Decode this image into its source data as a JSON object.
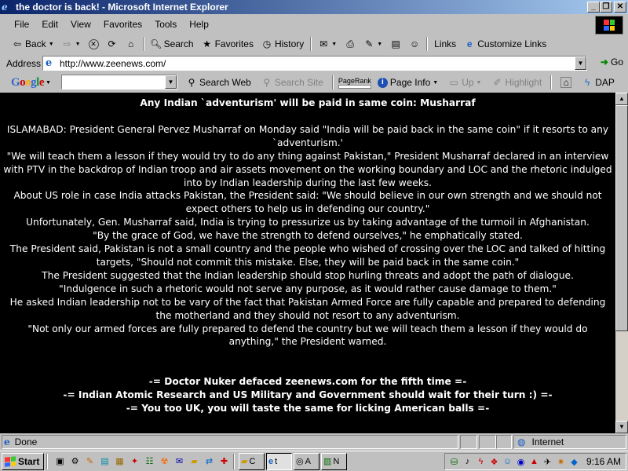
{
  "window": {
    "title": "the doctor is back! - Microsoft Internet Explorer",
    "min_label": "_",
    "max_label": "❐",
    "close_label": "✕"
  },
  "menu": {
    "items": [
      "File",
      "Edit",
      "View",
      "Favorites",
      "Tools",
      "Help"
    ]
  },
  "toolbar": {
    "back": "Back",
    "search": "Search",
    "favorites": "Favorites",
    "history": "History",
    "links": "Links",
    "customize_links": "Customize Links"
  },
  "address": {
    "label": "Address",
    "url": "http://www.zeenews.com/",
    "go": "Go"
  },
  "googlebar": {
    "logo": "Google",
    "search_web": "Search Web",
    "search_site": "Search Site",
    "pagerank": "PageRank",
    "page_info": "Page Info",
    "up": "Up",
    "highlight": "Highlight",
    "dap": "DAP"
  },
  "article": {
    "headline": "Any Indian `adventurism' will be paid in same coin: Musharraf",
    "paragraphs": [
      "ISLAMABAD: President General Pervez Musharraf on Monday said \"India will be paid back in the same coin\" if it resorts to any `adventurism.'",
      "\"We will teach them a lesson if they would try to do any thing against Pakistan,\" President  Musharraf declared in an interview with PTV in the backdrop of Indian troop and air assets  movement on the working boundary and LOC and the rhetoric indulged into by Indian leadership during the last few weeks.",
      "About US role in case India attacks Pakistan, the President said: \"We should believe in our own strength and we should not expect others to help us in defending our country.\"",
      "Unfortunately, Gen. Musharraf said, India is trying to pressurize us by taking advantage of the turmoil in Afghanistan.",
      "\"By the grace of God, we have the strength to defend ourselves,\" he emphatically stated.",
      "The President said, Pakistan is not a small country and the people who wished of crossing over the LOC and talked of hitting targets, \"Should not commit this mistake. Else, they will be paid back in the same coin.\"",
      "The President suggested that the Indian leadership should stop hurling threats and adopt the path of dialogue.",
      "\"Indulgence in such a rhetoric would not serve any purpose, as it would rather cause damage to them.\"",
      "He asked Indian leadership not to be vary of the fact that Pakistan Armed Force are fully capable and prepared to defending the motherland and they should not resort to any adventurism.",
      "\"Not only our armed forces are fully prepared to defend the country but we will teach them a lesson if they would do anything,\" the President warned."
    ],
    "deface_lines": [
      "-= Doctor Nuker defaced zeenews.com for the fifth time =-",
      "-= Indian Atomic Research and US Military and Government should wait for their turn :) =-",
      "-= You too UK, you will taste the same for licking American balls =-"
    ]
  },
  "status": {
    "text": "Done",
    "zone": "Internet"
  },
  "taskbar": {
    "start": "Start",
    "tasks": [
      {
        "label": "C",
        "icon": "folder-icon"
      },
      {
        "label": "t",
        "icon": "ie-icon"
      },
      {
        "label": "A",
        "icon": "app-icon"
      },
      {
        "label": "N",
        "icon": "notepad-icon"
      }
    ],
    "clock": "9:16 AM"
  }
}
